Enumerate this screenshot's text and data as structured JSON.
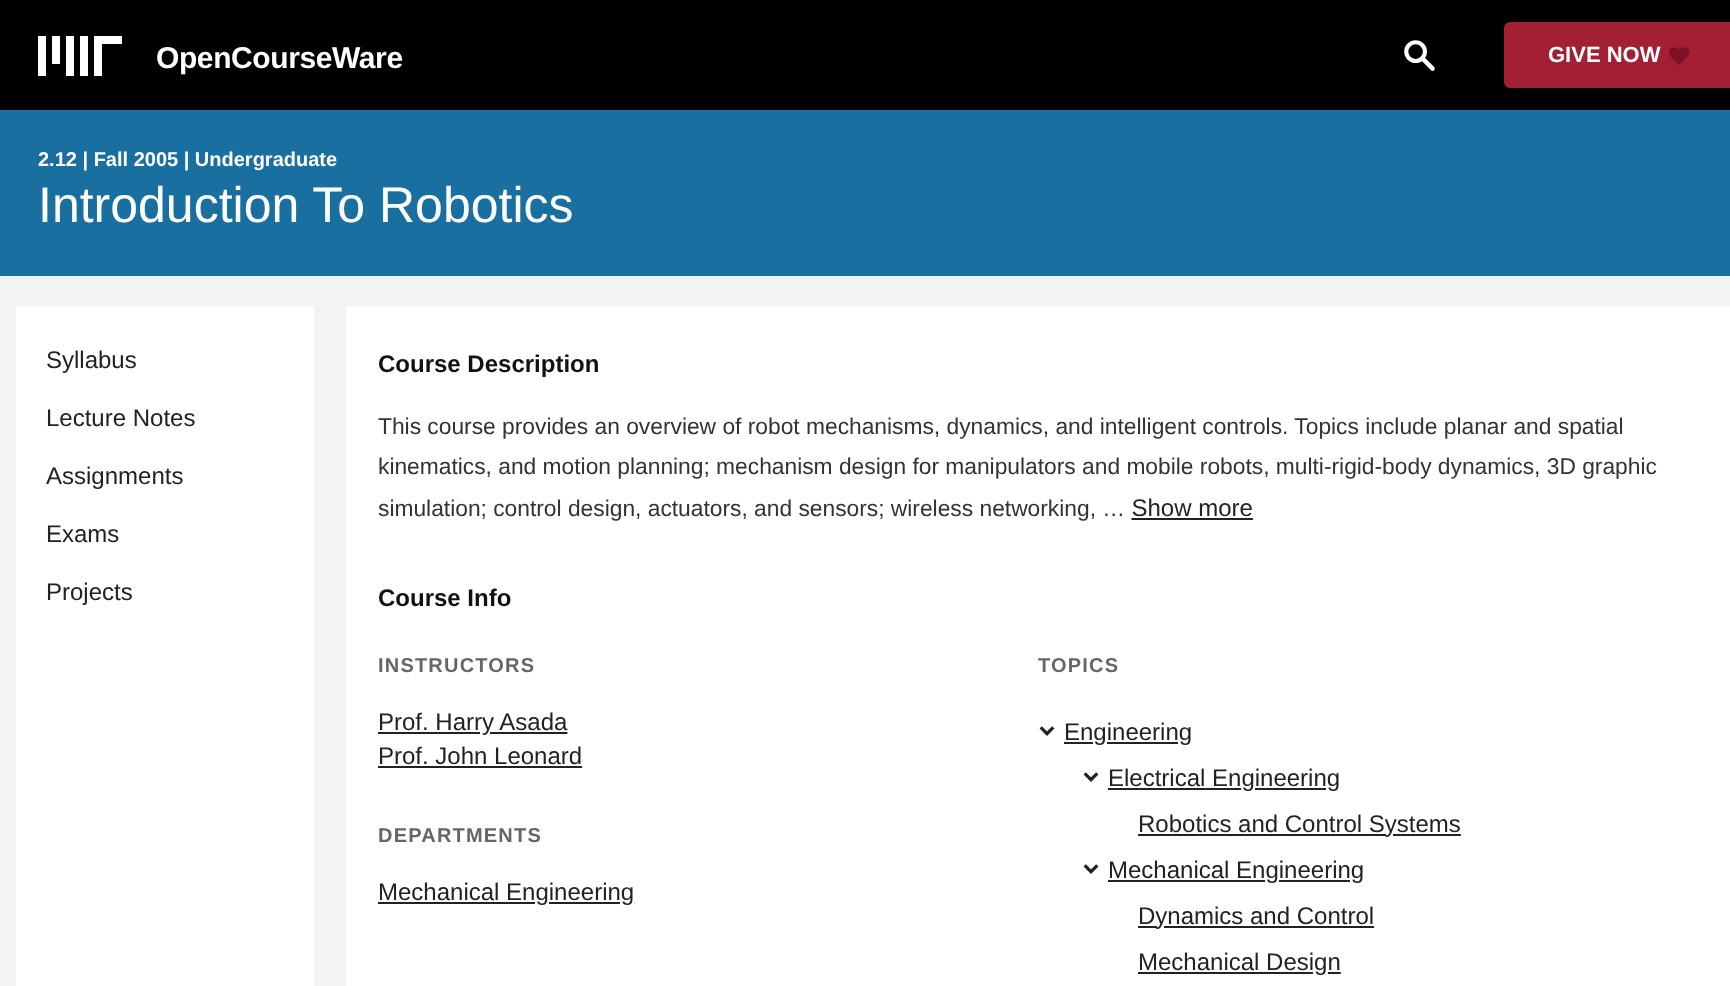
{
  "header": {
    "site_name": "OpenCourseWare",
    "give_button": "GIVE NOW"
  },
  "banner": {
    "meta": "2.12 | Fall 2005 | Undergraduate",
    "title": "Introduction To Robotics"
  },
  "sidebar": {
    "items": [
      "Syllabus",
      "Lecture Notes",
      "Assignments",
      "Exams",
      "Projects"
    ]
  },
  "description": {
    "heading": "Course Description",
    "text": "This course provides an overview of robot mechanisms, dynamics, and intelligent controls. Topics include planar and spatial kinematics, and motion planning; mechanism design for manipulators and mobile robots, multi-rigid-body dynamics, 3D graphic simulation; control design, actuators, and sensors; wireless networking, …",
    "more_link": "Show more"
  },
  "course_info": {
    "heading": "Course Info",
    "instructors_label": "INSTRUCTORS",
    "instructors": [
      "Prof. Harry Asada",
      "Prof. John Leonard"
    ],
    "departments_label": "DEPARTMENTS",
    "departments": [
      "Mechanical Engineering"
    ],
    "topics_label": "TOPICS",
    "topics": [
      {
        "label": "Engineering",
        "expanded": true,
        "children": [
          {
            "label": "Electrical Engineering",
            "expanded": true,
            "children": [
              {
                "label": "Robotics and Control Systems"
              }
            ]
          },
          {
            "label": "Mechanical Engineering",
            "expanded": true,
            "children": [
              {
                "label": "Dynamics and Control"
              },
              {
                "label": "Mechanical Design"
              }
            ]
          }
        ]
      }
    ]
  }
}
